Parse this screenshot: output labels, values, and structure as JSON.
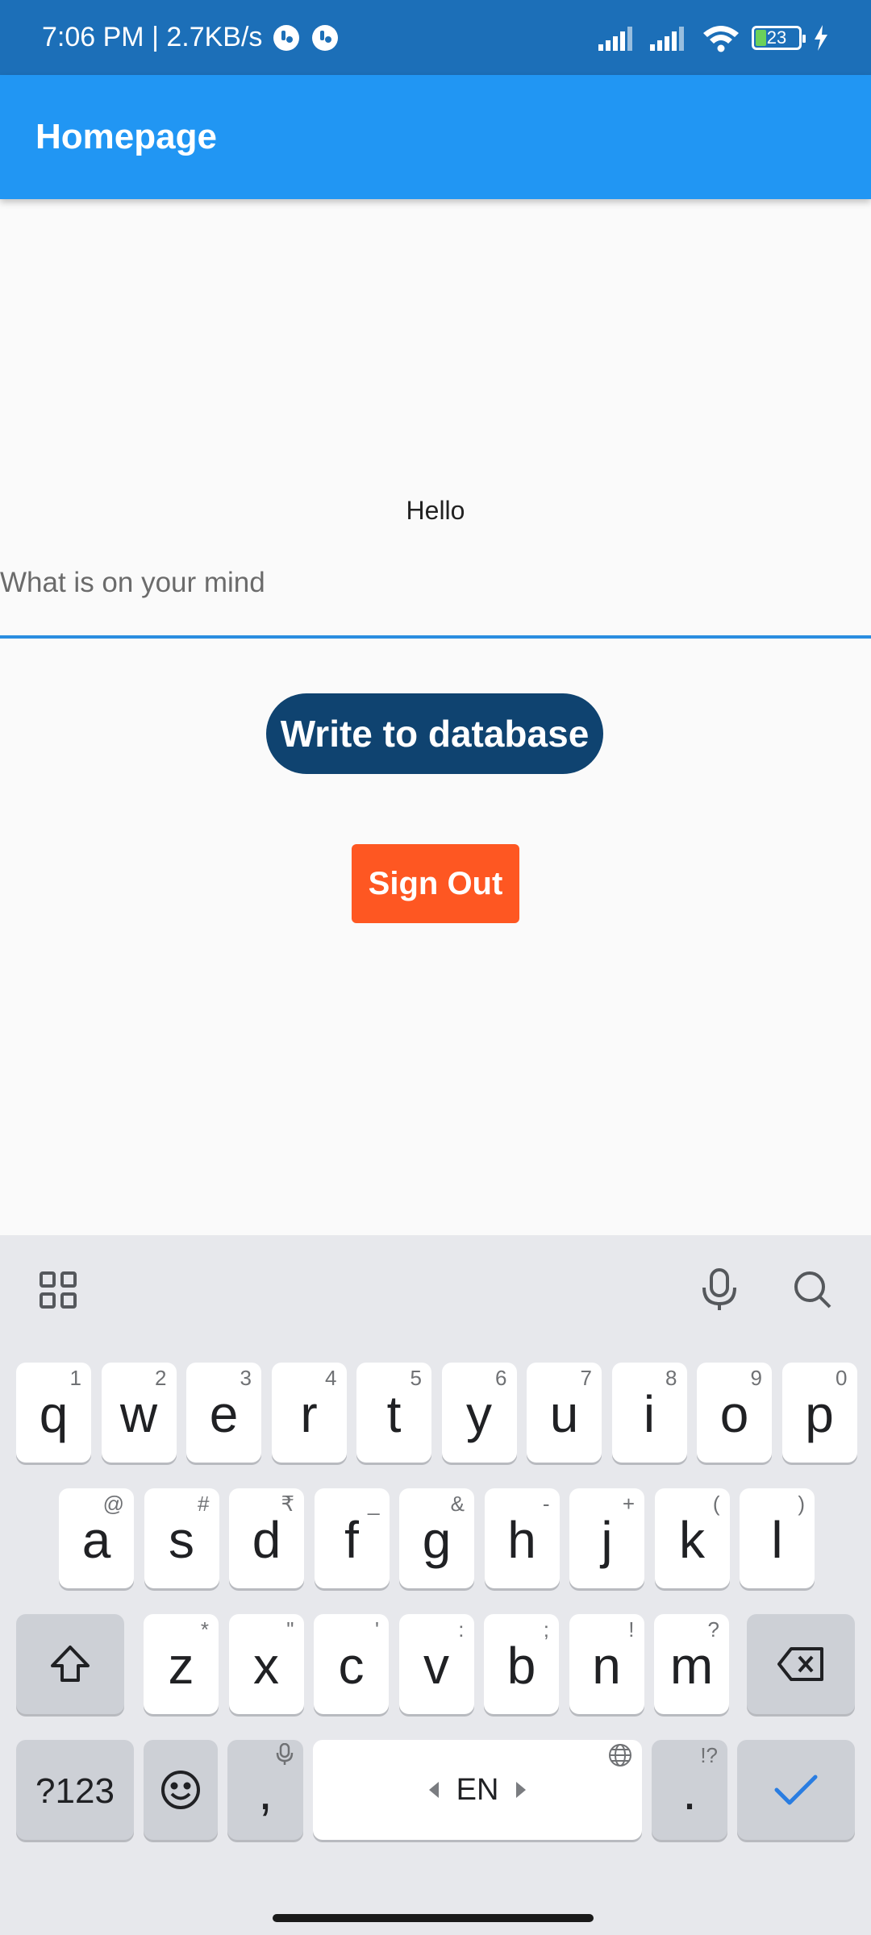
{
  "status_bar": {
    "time_speed": "7:06 PM | 2.7KB/s",
    "battery": "23"
  },
  "app_bar": {
    "title": "Homepage"
  },
  "main": {
    "greeting": "Hello",
    "input_placeholder": "What is on your mind",
    "input_value": "",
    "write_button": "Write to database",
    "signout_button": "Sign Out"
  },
  "keyboard": {
    "row1": [
      {
        "key": "q",
        "hint": "1"
      },
      {
        "key": "w",
        "hint": "2"
      },
      {
        "key": "e",
        "hint": "3"
      },
      {
        "key": "r",
        "hint": "4"
      },
      {
        "key": "t",
        "hint": "5"
      },
      {
        "key": "y",
        "hint": "6"
      },
      {
        "key": "u",
        "hint": "7"
      },
      {
        "key": "i",
        "hint": "8"
      },
      {
        "key": "o",
        "hint": "9"
      },
      {
        "key": "p",
        "hint": "0"
      }
    ],
    "row2": [
      {
        "key": "a",
        "hint": "@"
      },
      {
        "key": "s",
        "hint": "#"
      },
      {
        "key": "d",
        "hint": "₹"
      },
      {
        "key": "f",
        "hint": "_"
      },
      {
        "key": "g",
        "hint": "&"
      },
      {
        "key": "h",
        "hint": "-"
      },
      {
        "key": "j",
        "hint": "+"
      },
      {
        "key": "k",
        "hint": "("
      },
      {
        "key": "l",
        "hint": ")"
      }
    ],
    "row3": [
      {
        "key": "z",
        "hint": "*"
      },
      {
        "key": "x",
        "hint": "\""
      },
      {
        "key": "c",
        "hint": "'"
      },
      {
        "key": "v",
        "hint": ":"
      },
      {
        "key": "b",
        "hint": ";"
      },
      {
        "key": "n",
        "hint": "!"
      },
      {
        "key": "m",
        "hint": "?"
      }
    ],
    "symbols_key": "?123",
    "comma_key": ",",
    "space_label": "EN",
    "period_key": ".",
    "period_hint": "!?"
  },
  "colors": {
    "status_bar": "#1c6fb8",
    "app_bar": "#2196f3",
    "write_button": "#0f4370",
    "signout_button": "#fe5722",
    "input_underline": "#2a8ee0",
    "enter_check": "#2a7de1"
  },
  "icons": {
    "status": [
      "notification-app-icon",
      "notification-app-icon",
      "signal-icon",
      "signal-icon",
      "wifi-icon",
      "battery-icon",
      "charging-icon"
    ],
    "keyboard_toolbar": [
      "grid-icon",
      "microphone-icon",
      "search-icon"
    ],
    "keys": [
      "shift-icon",
      "backspace-icon",
      "emoji-icon",
      "globe-icon",
      "check-icon"
    ]
  }
}
